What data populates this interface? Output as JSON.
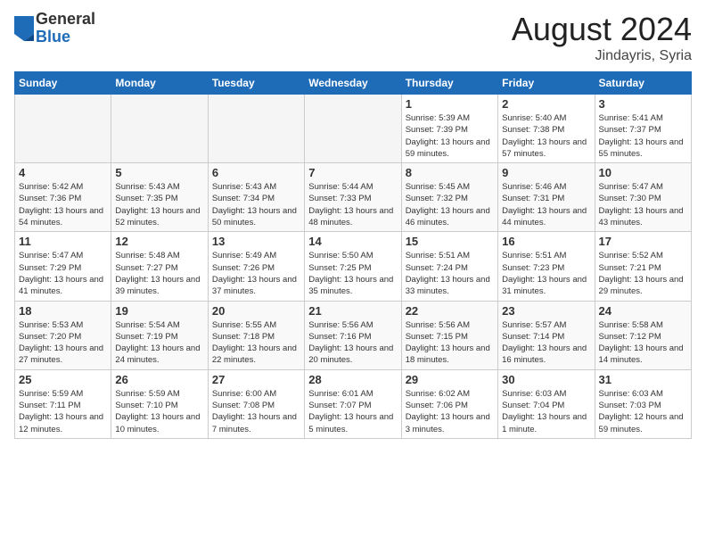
{
  "logo": {
    "general": "General",
    "blue": "Blue"
  },
  "title": "August 2024",
  "location": "Jindayris, Syria",
  "weekdays": [
    "Sunday",
    "Monday",
    "Tuesday",
    "Wednesday",
    "Thursday",
    "Friday",
    "Saturday"
  ],
  "weeks": [
    [
      {
        "day": "",
        "empty": true
      },
      {
        "day": "",
        "empty": true
      },
      {
        "day": "",
        "empty": true
      },
      {
        "day": "",
        "empty": true
      },
      {
        "day": "1",
        "sunrise": "5:39 AM",
        "sunset": "7:39 PM",
        "daylight": "13 hours and 59 minutes."
      },
      {
        "day": "2",
        "sunrise": "5:40 AM",
        "sunset": "7:38 PM",
        "daylight": "13 hours and 57 minutes."
      },
      {
        "day": "3",
        "sunrise": "5:41 AM",
        "sunset": "7:37 PM",
        "daylight": "13 hours and 55 minutes."
      }
    ],
    [
      {
        "day": "4",
        "sunrise": "5:42 AM",
        "sunset": "7:36 PM",
        "daylight": "13 hours and 54 minutes."
      },
      {
        "day": "5",
        "sunrise": "5:43 AM",
        "sunset": "7:35 PM",
        "daylight": "13 hours and 52 minutes."
      },
      {
        "day": "6",
        "sunrise": "5:43 AM",
        "sunset": "7:34 PM",
        "daylight": "13 hours and 50 minutes."
      },
      {
        "day": "7",
        "sunrise": "5:44 AM",
        "sunset": "7:33 PM",
        "daylight": "13 hours and 48 minutes."
      },
      {
        "day": "8",
        "sunrise": "5:45 AM",
        "sunset": "7:32 PM",
        "daylight": "13 hours and 46 minutes."
      },
      {
        "day": "9",
        "sunrise": "5:46 AM",
        "sunset": "7:31 PM",
        "daylight": "13 hours and 44 minutes."
      },
      {
        "day": "10",
        "sunrise": "5:47 AM",
        "sunset": "7:30 PM",
        "daylight": "13 hours and 43 minutes."
      }
    ],
    [
      {
        "day": "11",
        "sunrise": "5:47 AM",
        "sunset": "7:29 PM",
        "daylight": "13 hours and 41 minutes."
      },
      {
        "day": "12",
        "sunrise": "5:48 AM",
        "sunset": "7:27 PM",
        "daylight": "13 hours and 39 minutes."
      },
      {
        "day": "13",
        "sunrise": "5:49 AM",
        "sunset": "7:26 PM",
        "daylight": "13 hours and 37 minutes."
      },
      {
        "day": "14",
        "sunrise": "5:50 AM",
        "sunset": "7:25 PM",
        "daylight": "13 hours and 35 minutes."
      },
      {
        "day": "15",
        "sunrise": "5:51 AM",
        "sunset": "7:24 PM",
        "daylight": "13 hours and 33 minutes."
      },
      {
        "day": "16",
        "sunrise": "5:51 AM",
        "sunset": "7:23 PM",
        "daylight": "13 hours and 31 minutes."
      },
      {
        "day": "17",
        "sunrise": "5:52 AM",
        "sunset": "7:21 PM",
        "daylight": "13 hours and 29 minutes."
      }
    ],
    [
      {
        "day": "18",
        "sunrise": "5:53 AM",
        "sunset": "7:20 PM",
        "daylight": "13 hours and 27 minutes."
      },
      {
        "day": "19",
        "sunrise": "5:54 AM",
        "sunset": "7:19 PM",
        "daylight": "13 hours and 24 minutes."
      },
      {
        "day": "20",
        "sunrise": "5:55 AM",
        "sunset": "7:18 PM",
        "daylight": "13 hours and 22 minutes."
      },
      {
        "day": "21",
        "sunrise": "5:56 AM",
        "sunset": "7:16 PM",
        "daylight": "13 hours and 20 minutes."
      },
      {
        "day": "22",
        "sunrise": "5:56 AM",
        "sunset": "7:15 PM",
        "daylight": "13 hours and 18 minutes."
      },
      {
        "day": "23",
        "sunrise": "5:57 AM",
        "sunset": "7:14 PM",
        "daylight": "13 hours and 16 minutes."
      },
      {
        "day": "24",
        "sunrise": "5:58 AM",
        "sunset": "7:12 PM",
        "daylight": "13 hours and 14 minutes."
      }
    ],
    [
      {
        "day": "25",
        "sunrise": "5:59 AM",
        "sunset": "7:11 PM",
        "daylight": "13 hours and 12 minutes."
      },
      {
        "day": "26",
        "sunrise": "5:59 AM",
        "sunset": "7:10 PM",
        "daylight": "13 hours and 10 minutes."
      },
      {
        "day": "27",
        "sunrise": "6:00 AM",
        "sunset": "7:08 PM",
        "daylight": "13 hours and 7 minutes."
      },
      {
        "day": "28",
        "sunrise": "6:01 AM",
        "sunset": "7:07 PM",
        "daylight": "13 hours and 5 minutes."
      },
      {
        "day": "29",
        "sunrise": "6:02 AM",
        "sunset": "7:06 PM",
        "daylight": "13 hours and 3 minutes."
      },
      {
        "day": "30",
        "sunrise": "6:03 AM",
        "sunset": "7:04 PM",
        "daylight": "13 hours and 1 minute."
      },
      {
        "day": "31",
        "sunrise": "6:03 AM",
        "sunset": "7:03 PM",
        "daylight": "12 hours and 59 minutes."
      }
    ]
  ]
}
